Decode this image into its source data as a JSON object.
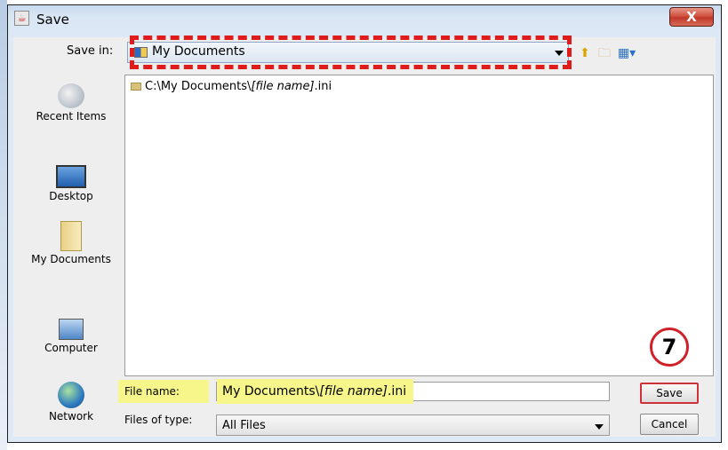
{
  "window": {
    "title": "Save",
    "close_label": "X"
  },
  "save_in": {
    "label": "Save in:",
    "value": "My Documents"
  },
  "toolbar": {
    "icons": [
      "up-folder-icon",
      "new-folder-icon",
      "view-menu-icon"
    ]
  },
  "places": [
    {
      "id": "recent",
      "label": "Recent Items"
    },
    {
      "id": "desktop",
      "label": "Desktop"
    },
    {
      "id": "mydocs",
      "label": "My Documents"
    },
    {
      "id": "computer",
      "label": "Computer"
    },
    {
      "id": "network",
      "label": "Network"
    }
  ],
  "file_list": {
    "items": [
      {
        "prefix": "C:\\My Documents\\",
        "name_italic": "[file name]",
        "suffix": ".ini"
      }
    ]
  },
  "file_name": {
    "label": "File name:",
    "prefix": "My Documents\\",
    "name_italic": "[file name]",
    "suffix": ".ini"
  },
  "files_of_type": {
    "label": "Files of type:",
    "value": "All Files"
  },
  "buttons": {
    "save": "Save",
    "cancel": "Cancel"
  },
  "annotation": {
    "step": "7"
  },
  "colors": {
    "highlight_dashed": "#e01b1b",
    "highlight_yellow": "#f6f68a",
    "step_circle": "#d0202a"
  }
}
